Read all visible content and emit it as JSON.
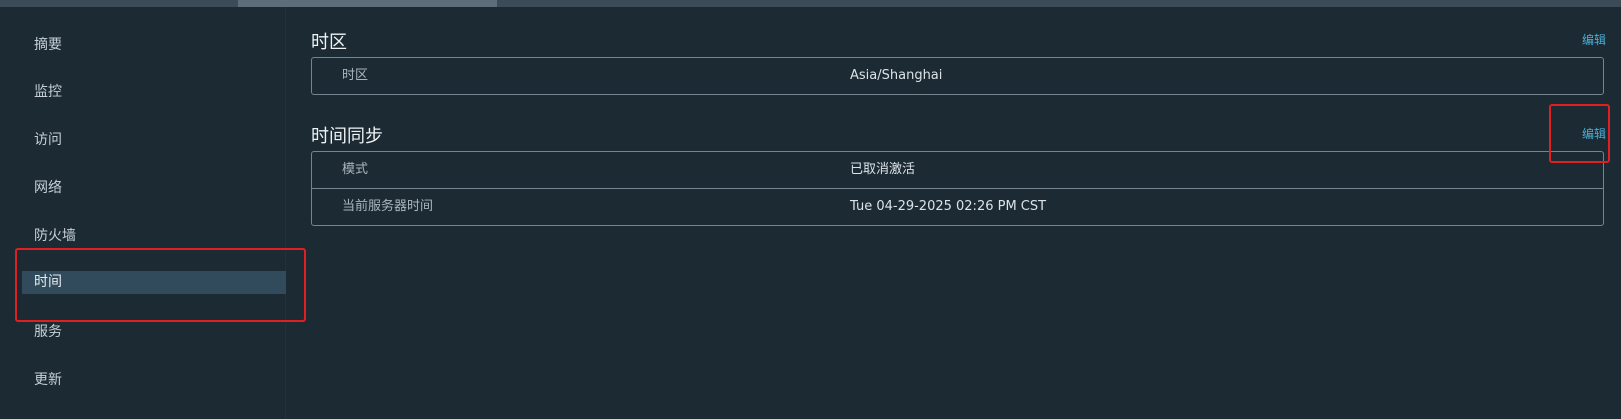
{
  "sidebar": {
    "items": [
      {
        "label": "摘要"
      },
      {
        "label": "监控"
      },
      {
        "label": "访问"
      },
      {
        "label": "网络"
      },
      {
        "label": "防火墙"
      },
      {
        "label": "时间"
      },
      {
        "label": "服务"
      },
      {
        "label": "更新"
      }
    ],
    "active": "时间"
  },
  "timezone": {
    "title": "时区",
    "edit_label": "编辑",
    "rows": [
      {
        "label": "时区",
        "value": "Asia/Shanghai"
      }
    ]
  },
  "time_sync": {
    "title": "时间同步",
    "edit_label": "编辑",
    "rows": [
      {
        "label": "模式",
        "value": "已取消激活"
      },
      {
        "label": "当前服务器时间",
        "value": "Tue 04-29-2025 02:26 PM CST"
      }
    ]
  },
  "colors": {
    "background": "#1b2a33",
    "active_nav": "#324b5c",
    "link": "#49afd9",
    "highlight": "#e02020"
  }
}
